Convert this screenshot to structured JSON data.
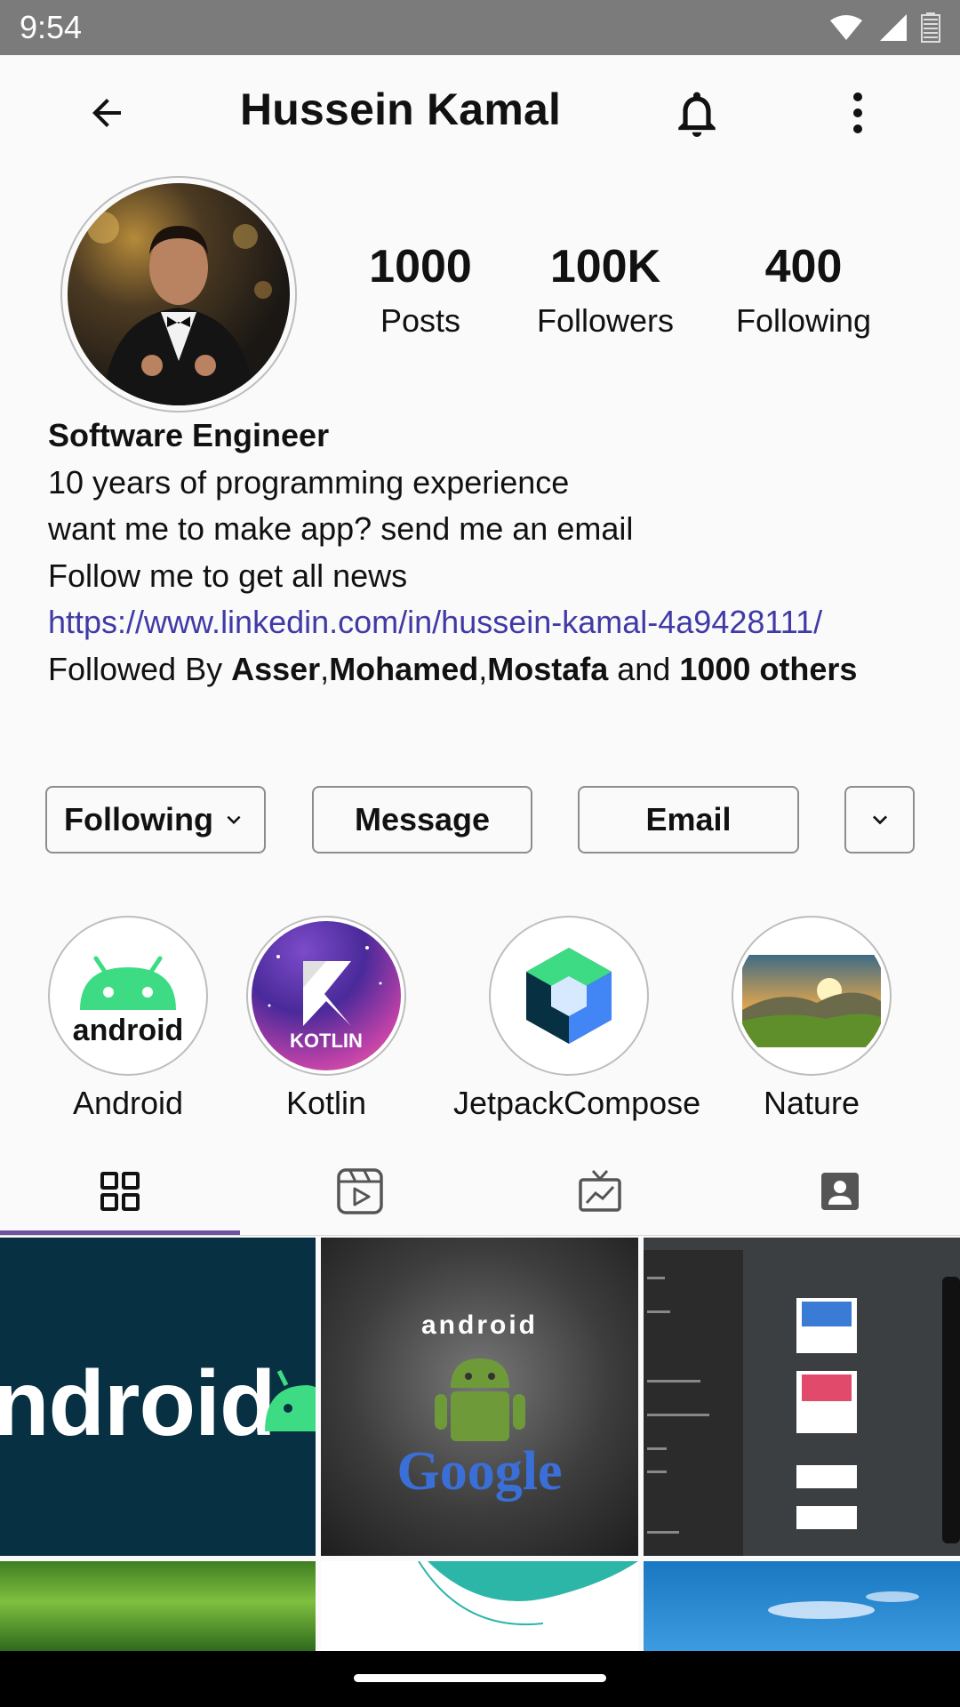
{
  "status_bar": {
    "time": "9:54"
  },
  "header": {
    "title": "Hussein Kamal"
  },
  "profile": {
    "avatar_icon": "profile-photo",
    "stats": [
      {
        "value": "1000",
        "label": "Posts"
      },
      {
        "value": "100K",
        "label": "Followers"
      },
      {
        "value": "400",
        "label": "Following"
      }
    ]
  },
  "bio": {
    "title": "Software Engineer",
    "lines": [
      "10 years of programming experience",
      "want me to make app? send me an email",
      "Follow me to get all news"
    ],
    "link": "https://www.linkedin.com/in/hussein-kamal-4a9428111/",
    "followed": {
      "prefix": "Followed By ",
      "names": [
        "Asser",
        "Mohamed",
        "Mostafa"
      ],
      "connector": " and ",
      "others": "1000 others"
    }
  },
  "actions": {
    "following": "Following",
    "message": "Message",
    "email": "Email"
  },
  "highlights": [
    {
      "label": "Android",
      "icon": "android-logo"
    },
    {
      "label": "Kotlin",
      "icon": "kotlin-logo",
      "badge": "KOTLIN"
    },
    {
      "label": "JetpackCompose",
      "icon": "jetpack-compose-logo"
    },
    {
      "label": "Nature",
      "icon": "landscape-photo"
    }
  ],
  "highlight_text": {
    "android_wordmark": "android"
  },
  "tabs": [
    {
      "name": "grid",
      "icon": "grid-icon"
    },
    {
      "name": "reels",
      "icon": "reels-icon"
    },
    {
      "name": "tv",
      "icon": "tv-icon"
    },
    {
      "name": "tagged",
      "icon": "tagged-person-icon"
    }
  ],
  "posts": {
    "post1_text": "ndroid",
    "post2_top": "android",
    "post2_bottom": "Google"
  },
  "colors": {
    "accent": "#6c51a3",
    "link": "#3f3aa6",
    "android_green": "#3ddc84"
  }
}
